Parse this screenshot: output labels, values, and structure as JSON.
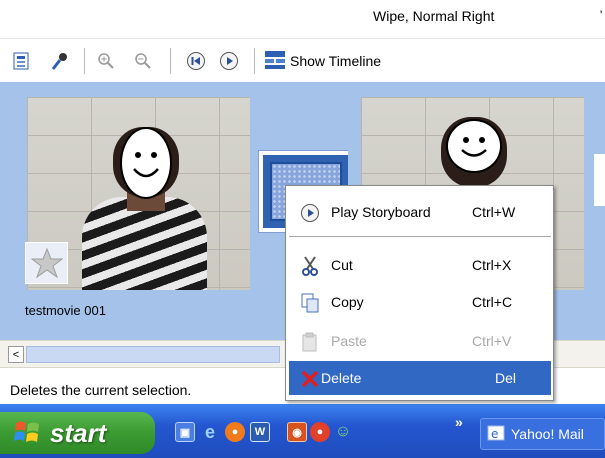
{
  "window": {
    "transition_label": "Wipe, Normal Right",
    "top_edge_char": "'"
  },
  "toolbar": {
    "show_timeline_label": "Show Timeline"
  },
  "storyboard": {
    "clips": [
      {
        "name": "testmovie 001"
      },
      {
        "name": ""
      }
    ]
  },
  "context_menu": {
    "items": [
      {
        "label": "Play Storyboard",
        "shortcut": "Ctrl+W",
        "icon": "play-icon",
        "enabled": true,
        "selected": false
      },
      {
        "label": "Cut",
        "shortcut": "Ctrl+X",
        "icon": "scissors-icon",
        "enabled": true,
        "selected": false
      },
      {
        "label": "Copy",
        "shortcut": "Ctrl+C",
        "icon": "copy-icon",
        "enabled": true,
        "selected": false
      },
      {
        "label": "Paste",
        "shortcut": "Ctrl+V",
        "icon": "paste-icon",
        "enabled": false,
        "selected": false
      },
      {
        "label": "Delete",
        "shortcut": "Del",
        "icon": "delete-x-icon",
        "enabled": true,
        "selected": true
      }
    ]
  },
  "scrollbar": {
    "left_arrow": "<"
  },
  "status_bar": {
    "text": "Deletes the current selection."
  },
  "taskbar": {
    "start_label": "start",
    "chevron": "»",
    "window_button_label": "Yahoo! Mail"
  },
  "colors": {
    "storyboard_bg": "#a5c2ea",
    "selection_blue": "#3168c4",
    "taskbar_blue": "#2456d0",
    "start_green": "#3b9b32",
    "delete_red": "#e02020"
  }
}
